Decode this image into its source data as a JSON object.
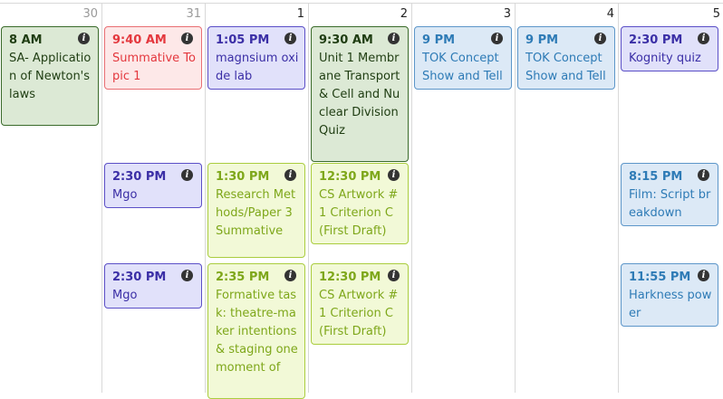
{
  "days": [
    "30",
    "31",
    "1",
    "2",
    "3",
    "4",
    "5"
  ],
  "events": [
    {
      "time": "8 AM",
      "title": "SA- Application of Newton's laws"
    },
    {
      "time": "9:40 AM",
      "title": "Summative Topic 1"
    },
    {
      "time": "2:30 PM",
      "title": "Mgo"
    },
    {
      "time": "2:30 PM",
      "title": "Mgo"
    },
    {
      "time": "1:05 PM",
      "title": "magnsium oxide lab"
    },
    {
      "time": "1:30 PM",
      "title": "Research Methods/Paper 3 Summative"
    },
    {
      "time": "2:35 PM",
      "title": "Formative task: theatre-maker intentions & staging one moment of"
    },
    {
      "time": "9:30 AM",
      "title": "Unit 1 Membrane Transport & Cell and Nuclear Division Quiz"
    },
    {
      "time": "12:30 PM",
      "title": "CS Artwork #1 Criterion C (First Draft)"
    },
    {
      "time": "12:30 PM",
      "title": "CS Artwork #1 Criterion C (First Draft)"
    },
    {
      "time": "9 PM",
      "title": "TOK Concept Show and Tell"
    },
    {
      "time": "9 PM",
      "title": "TOK Concept Show and Tell"
    },
    {
      "time": "2:30 PM",
      "title": "Kognity quiz"
    },
    {
      "time": "8:15 PM",
      "title": "Film: Script breakdown"
    },
    {
      "time": "11:55 PM",
      "title": "Harkness power"
    }
  ],
  "info_glyph": "i",
  "colors": {
    "green": "#dce9d5",
    "red": "#fde8e8",
    "purple": "#e1e1fa",
    "lime": "#f2f9d7",
    "blue": "#dce9f6"
  }
}
